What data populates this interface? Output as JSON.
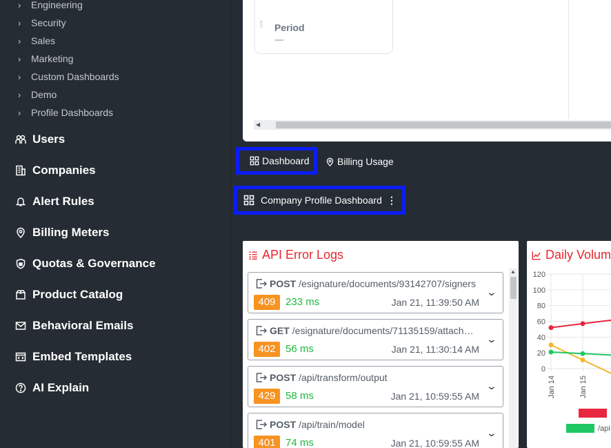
{
  "sidebar": {
    "subitems": [
      {
        "label": "Engineering"
      },
      {
        "label": "Security"
      },
      {
        "label": "Sales"
      },
      {
        "label": "Marketing"
      },
      {
        "label": "Custom Dashboards"
      },
      {
        "label": "Demo"
      },
      {
        "label": "Profile Dashboards"
      }
    ],
    "items": [
      {
        "label": "Users",
        "icon": "users-icon"
      },
      {
        "label": "Companies",
        "icon": "building-icon"
      },
      {
        "label": "Alert Rules",
        "icon": "bell-icon"
      },
      {
        "label": "Billing Meters",
        "icon": "map-pin-icon"
      },
      {
        "label": "Quotas & Governance",
        "icon": "shield-icon"
      },
      {
        "label": "Product Catalog",
        "icon": "box-icon"
      },
      {
        "label": "Behavioral Emails",
        "icon": "mail-icon"
      },
      {
        "label": "Embed Templates",
        "icon": "code-window-icon"
      },
      {
        "label": "AI Explain",
        "icon": "question-circle-icon"
      }
    ]
  },
  "topcard": {
    "period_label": "Period",
    "period_value": "—"
  },
  "tabs": {
    "dashboard": "Dashboard",
    "billing": "Billing Usage"
  },
  "company_button": {
    "label": "Company Profile Dashboard"
  },
  "error_logs": {
    "title": "API Error Logs",
    "entries": [
      {
        "method": "POST",
        "path": "/esignature/documents/93142707/signers",
        "status": "409",
        "duration": "233 ms",
        "time": "Jan 21, 11:39:50 AM"
      },
      {
        "method": "GET",
        "path": "/esignature/documents/71135159/attach…",
        "status": "402",
        "duration": "56 ms",
        "time": "Jan 21, 11:30:14 AM"
      },
      {
        "method": "POST",
        "path": "/api/transform/output",
        "status": "429",
        "duration": "58 ms",
        "time": "Jan 21, 10:59:55 AM"
      },
      {
        "method": "POST",
        "path": "/api/train/model",
        "status": "401",
        "duration": "74 ms",
        "time": "Jan 21, 10:59:55 AM"
      }
    ]
  },
  "daily_volume": {
    "title": "Daily Volume",
    "legend": [
      "",
      "/api"
    ]
  },
  "colors": {
    "accent_red": "#e8262d",
    "status_orange": "#f79321",
    "duration_green": "#1eb83c",
    "highlight_blue": "#0b1df5"
  },
  "chart_data": {
    "type": "line",
    "title": "Daily Volume",
    "x": [
      "Jan 14",
      "Jan 15"
    ],
    "yticks": [
      0,
      20,
      40,
      60,
      80,
      100,
      120
    ],
    "ylim": [
      0,
      120
    ],
    "series": [
      {
        "name": "",
        "color": "#e8263f",
        "values": [
          52,
          57
        ]
      },
      {
        "name": "",
        "color": "#f5b731",
        "values": [
          30,
          11
        ]
      },
      {
        "name": "/api",
        "color": "#1fc865",
        "values": [
          21,
          19
        ]
      }
    ]
  }
}
